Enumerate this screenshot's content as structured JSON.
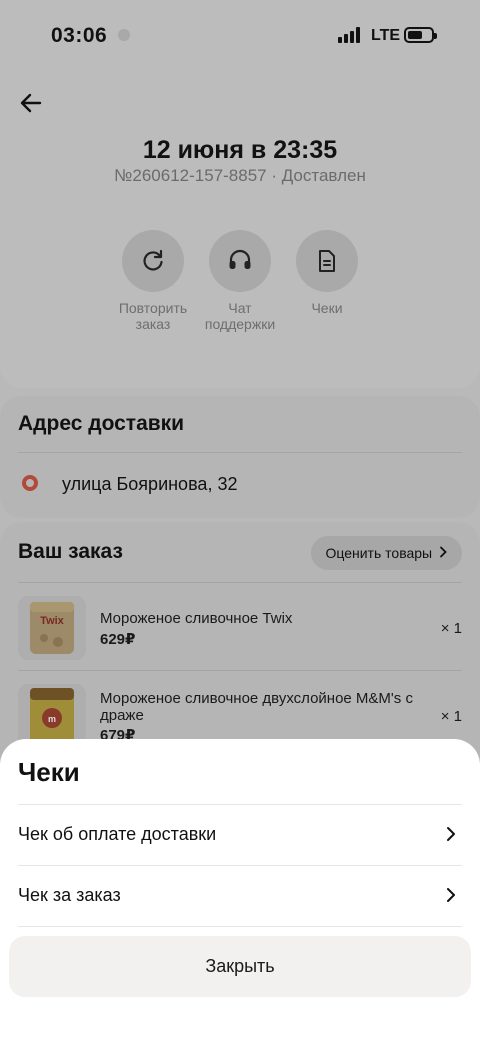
{
  "status_bar": {
    "time": "03:06",
    "network": "LTE"
  },
  "order": {
    "title": "12 июня в 23:35",
    "subtitle": "№260612-157-8857 · Доставлен"
  },
  "actions": [
    {
      "label": "Повторить заказ",
      "icon": "repeat-icon"
    },
    {
      "label": "Чат поддержки",
      "icon": "headset-icon"
    },
    {
      "label": "Чеки",
      "icon": "document-icon"
    }
  ],
  "address": {
    "title": "Адрес доставки",
    "street": "улица Бояринова, 32"
  },
  "your_order": {
    "title": "Ваш заказ",
    "rate_button": "Оценить товары",
    "items": [
      {
        "name": "Мороженое сливочное Twix",
        "price": "629₽",
        "qty": "× 1"
      },
      {
        "name": "Мороженое сливочное двухслойное M&M's с драже",
        "price": "679₽",
        "qty": "× 1"
      }
    ]
  },
  "sheet": {
    "title": "Чеки",
    "rows": [
      {
        "label": "Чек об оплате доставки"
      },
      {
        "label": "Чек за заказ"
      }
    ],
    "close_label": "Закрыть"
  },
  "colors": {
    "overlay_bg": "#b9b9b9",
    "sheet_bg": "#ffffff",
    "close_button_bg": "#f2f1ef",
    "address_marker": "#b24a3a"
  }
}
